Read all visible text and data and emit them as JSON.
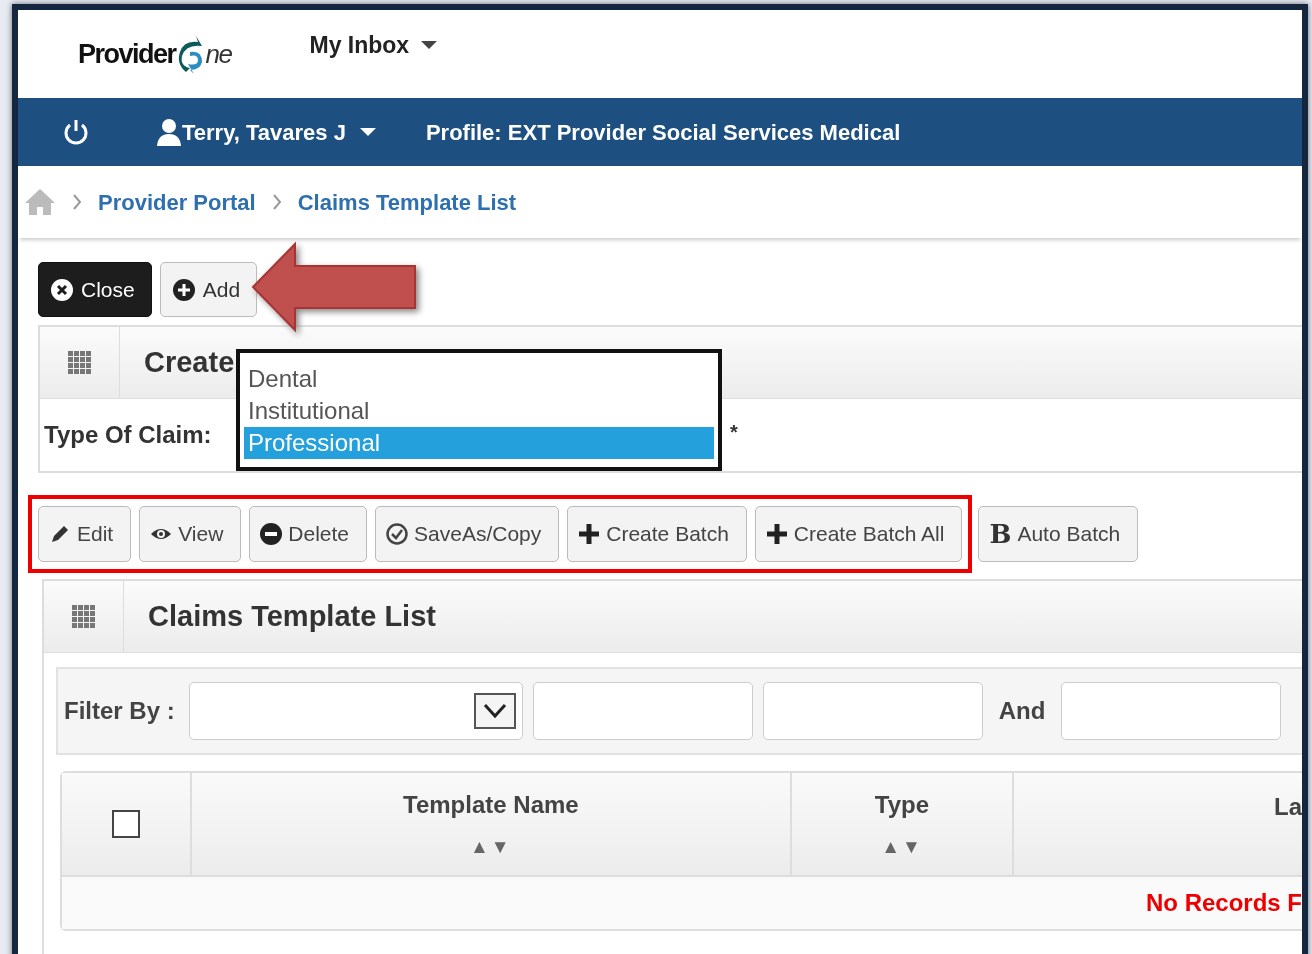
{
  "header": {
    "logo_start": "Provider",
    "logo_end": "ne",
    "menu": "My Inbox"
  },
  "user_bar": {
    "user": "Terry, Tavares J",
    "profile": "Profile: EXT Provider Social Services Medical"
  },
  "breadcrumb": [
    "Provider Portal",
    "Claims Template List"
  ],
  "actions": [
    {
      "label": "Close",
      "kind": "dark"
    },
    {
      "label": "Add",
      "kind": "light"
    }
  ],
  "create_panel": {
    "title": "Create",
    "field_label": "Type Of Claim:",
    "required_mark": "*",
    "options": [
      {
        "label": "Dental",
        "selected": false
      },
      {
        "label": "Institutional",
        "selected": false
      },
      {
        "label": "Professional",
        "selected": true
      }
    ]
  },
  "toolbar": [
    {
      "label": "Edit"
    },
    {
      "label": "View"
    },
    {
      "label": "Delete"
    },
    {
      "label": "SaveAs/Copy"
    },
    {
      "label": "Create Batch"
    },
    {
      "label": "Create Batch All"
    },
    {
      "label": "Auto Batch",
      "glyph": "B"
    }
  ],
  "list_panel": {
    "title": "Claims Template List",
    "filter_label": "Filter By :",
    "and_label": "And",
    "columns": [
      {
        "kind": "checkbox",
        "checked": false
      },
      {
        "kind": "text",
        "header": "Template Name",
        "sort": "▲▼"
      },
      {
        "kind": "text",
        "header": "Type",
        "sort": "▲▼"
      },
      {
        "kind": "text",
        "header": "La"
      }
    ],
    "empty_message": "No Records F"
  }
}
